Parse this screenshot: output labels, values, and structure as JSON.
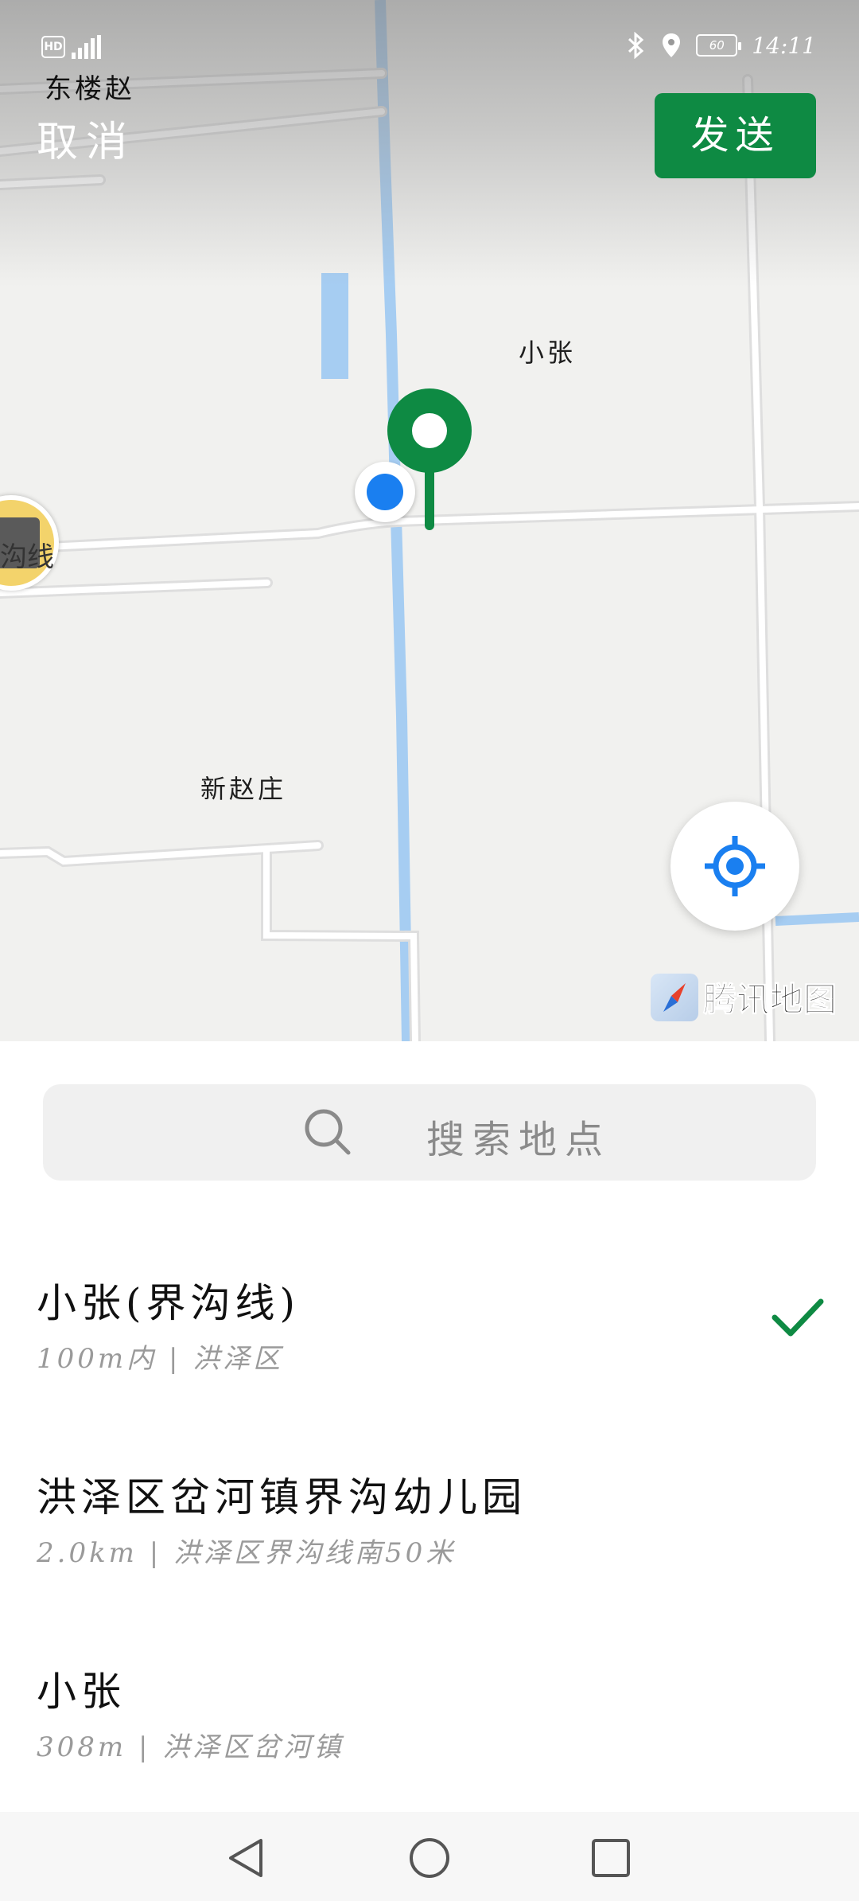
{
  "status_bar": {
    "hd": "HD",
    "network": "4G",
    "time": "14:11",
    "battery": "60"
  },
  "header": {
    "cancel_label": "取消",
    "send_label": "发送"
  },
  "map": {
    "labels": {
      "top_left_place": "东楼赵",
      "marker_place": "小张",
      "village": "新赵庄",
      "edge_poi": "沟线"
    },
    "attribution": "腾讯地图",
    "colors": {
      "pin": "#0e8a43",
      "my_location": "#1a7ff0",
      "water": "#a6cdf2"
    }
  },
  "search": {
    "placeholder": "搜索地点"
  },
  "places": [
    {
      "name": "小张(界沟线)",
      "detail": "100m内 | 洪泽区",
      "selected": true
    },
    {
      "name": "洪泽区岔河镇界沟幼儿园",
      "detail": "2.0km | 洪泽区界沟线南50米",
      "selected": false
    },
    {
      "name": "小张",
      "detail": "308m | 洪泽区岔河镇",
      "selected": false
    }
  ],
  "navbar": {
    "icons": [
      "back-icon",
      "home-icon",
      "recent-apps-icon"
    ]
  }
}
